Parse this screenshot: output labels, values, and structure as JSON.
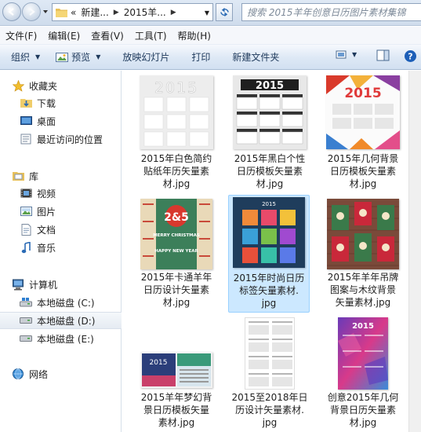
{
  "address": {
    "crumbs": [
      "«",
      "新建...",
      "2015羊..."
    ],
    "search_placeholder": "搜索 2015羊年创意日历图片素材集锦"
  },
  "menu": [
    "文件(F)",
    "编辑(E)",
    "查看(V)",
    "工具(T)",
    "帮助(H)"
  ],
  "toolbar": {
    "organize": "组织",
    "preview": "预览",
    "slideshow": "放映幻灯片",
    "print": "打印",
    "new_folder": "新建文件夹"
  },
  "nav": {
    "favorites": "收藏夹",
    "downloads": "下载",
    "desktop": "桌面",
    "recent": "最近访问的位置",
    "library": "库",
    "videos": "视频",
    "pictures": "图片",
    "documents": "文档",
    "music": "音乐",
    "computer": "计算机",
    "disk_c": "本地磁盘 (C:)",
    "disk_d": "本地磁盘 (D:)",
    "disk_e": "本地磁盘 (E:)",
    "network": "网络"
  },
  "files": [
    {
      "name": "2015年白色简约贴纸年历矢量素材.jpg",
      "thumb_text": "2015"
    },
    {
      "name": "2015年黑白个性日历模板矢量素材.jpg",
      "thumb_text": "2015"
    },
    {
      "name": "2015年几何背景日历模板矢量素材.jpg",
      "thumb_text": "2015"
    },
    {
      "name": "2015年卡通羊年日历设计矢量素材.jpg",
      "thumb_text": "2015"
    },
    {
      "name": "2015年时尚日历标签矢量素材.jpg",
      "thumb_text": "2015"
    },
    {
      "name": "2015年羊年吊牌图案与木纹背景矢量素材.jpg",
      "thumb_text": ""
    },
    {
      "name": "2015羊年梦幻背景日历模板矢量素材.jpg",
      "thumb_text": "2015"
    },
    {
      "name": "2015至2018年日历设计矢量素材.jpg",
      "thumb_text": ""
    },
    {
      "name": "创意2015年几何背景日历矢量素材.jpg",
      "thumb_text": "2015"
    }
  ],
  "captions": [
    [
      "2015年白色简约",
      "贴纸年历矢量素",
      "材.jpg"
    ],
    [
      "2015年黑白个性",
      "日历模板矢量素",
      "材.jpg"
    ],
    [
      "2015年几何背景",
      "日历模板矢量素",
      "材.jpg"
    ],
    [
      "2015年卡通羊年",
      "日历设计矢量素",
      "材.jpg"
    ],
    [
      "2015年时尚日历",
      "标签矢量素材.",
      "jpg"
    ],
    [
      "2015年羊年吊牌",
      "图案与木纹背景",
      "矢量素材.jpg"
    ],
    [
      "2015羊年梦幻背",
      "景日历模板矢量",
      "素材.jpg"
    ],
    [
      "2015至2018年日",
      "历设计矢量素材.",
      "jpg"
    ],
    [
      "创意2015年几何",
      "背景日历矢量素",
      "材.jpg"
    ]
  ],
  "thumb_texts": {
    "merry": "MERRY CHRISTMAS",
    "happy": "HAPPY NEW YEAR",
    "t4": "2&5"
  },
  "colors": {
    "selection": "#cce8ff",
    "toolbar_text": "#1e395b"
  }
}
